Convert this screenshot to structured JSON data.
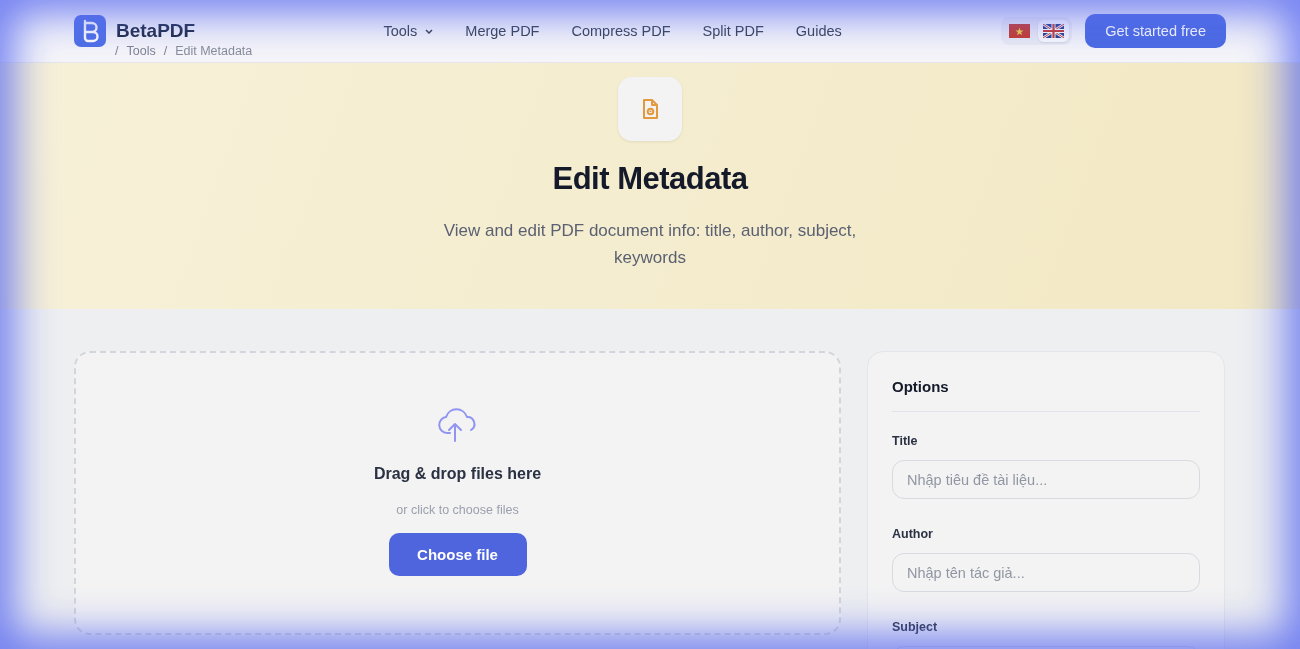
{
  "header": {
    "brand": "BetaPDF",
    "nav": [
      {
        "label": "Tools",
        "dropdown": true
      },
      {
        "label": "Merge PDF",
        "dropdown": false
      },
      {
        "label": "Compress PDF",
        "dropdown": false
      },
      {
        "label": "Split PDF",
        "dropdown": false
      },
      {
        "label": "Guides",
        "dropdown": false
      }
    ],
    "languages": [
      {
        "kind": "vn",
        "selected": false
      },
      {
        "kind": "uk",
        "selected": true
      }
    ],
    "cta": "Get started free"
  },
  "breadcrumb": [
    {
      "separator": "/",
      "label": "Tools"
    },
    {
      "separator": "/",
      "label": "Edit Metadata"
    }
  ],
  "hero": {
    "title": "Edit Metadata",
    "subtitle": "View and edit PDF document info: title, author, subject, keywords"
  },
  "upload": {
    "title": "Drag & drop files here",
    "hint": "or click to choose files",
    "button": "Choose file"
  },
  "options": {
    "title": "Options",
    "fields": [
      {
        "label": "Title",
        "placeholder": "Nhập tiêu đề tài liệu..."
      },
      {
        "label": "Author",
        "placeholder": "Nhập tên tác giả..."
      },
      {
        "label": "Subject"
      }
    ]
  }
}
